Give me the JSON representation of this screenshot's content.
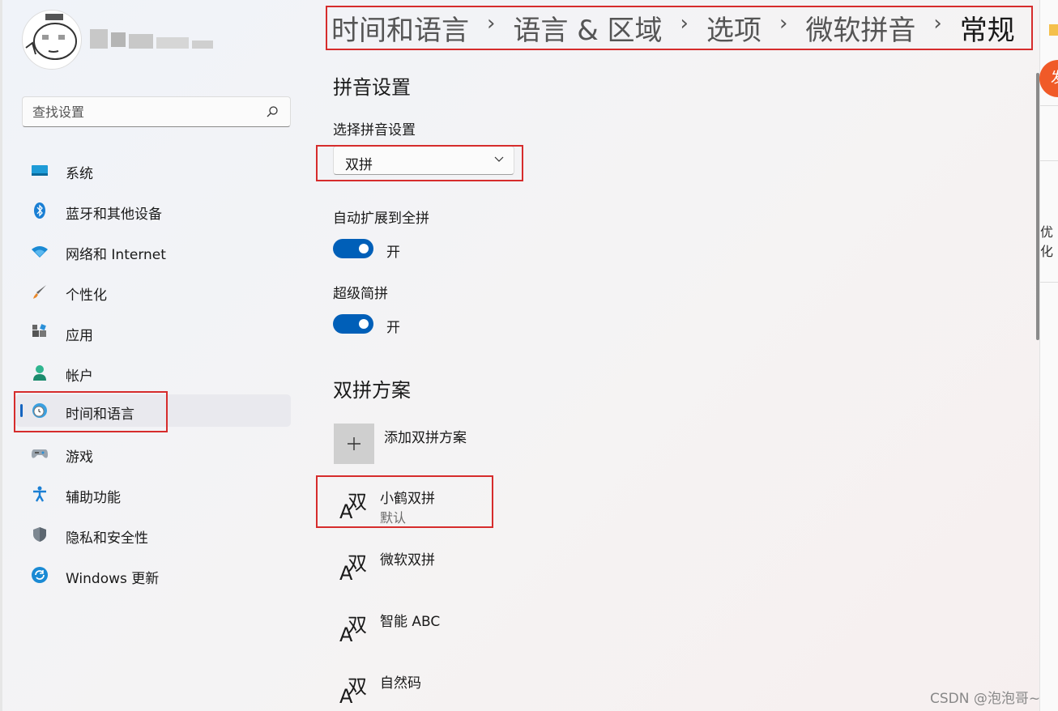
{
  "search": {
    "placeholder": "查找设置"
  },
  "nav": {
    "items": [
      {
        "label": "系统",
        "icon": "display-icon"
      },
      {
        "label": "蓝牙和其他设备",
        "icon": "bluetooth-icon"
      },
      {
        "label": "网络和 Internet",
        "icon": "wifi-icon"
      },
      {
        "label": "个性化",
        "icon": "brush-icon"
      },
      {
        "label": "应用",
        "icon": "apps-icon"
      },
      {
        "label": "帐户",
        "icon": "person-icon"
      },
      {
        "label": "时间和语言",
        "icon": "globe-clock-icon",
        "active": true
      },
      {
        "label": "游戏",
        "icon": "gamepad-icon"
      },
      {
        "label": "辅助功能",
        "icon": "accessibility-icon"
      },
      {
        "label": "隐私和安全性",
        "icon": "shield-icon"
      },
      {
        "label": "Windows 更新",
        "icon": "update-icon"
      }
    ]
  },
  "breadcrumb": [
    "时间和语言",
    "语言 & 区域",
    "选项",
    "微软拼音",
    "常规"
  ],
  "breadcrumb_separator": "›",
  "pinyin": {
    "title": "拼音设置",
    "select_label": "选择拼音设置",
    "select_value": "双拼",
    "auto_expand_label": "自动扩展到全拼",
    "auto_expand_state": "开",
    "super_label": "超级简拼",
    "super_state": "开"
  },
  "shuangpin": {
    "title": "双拼方案",
    "add_label": "添加双拼方案",
    "icon_glyph_a": "A",
    "icon_glyph_z": "双",
    "schemes": [
      {
        "name": "小鹤双拼",
        "sub": "默认"
      },
      {
        "name": "微软双拼"
      },
      {
        "name": "智能 ABC"
      },
      {
        "name": "自然码"
      }
    ]
  },
  "side": {
    "orange_glyph": "发",
    "text": "优化"
  },
  "watermark": "CSDN @泡泡哥~",
  "colors": {
    "accent": "#005fb8",
    "highlight_box": "#d62c2c"
  }
}
